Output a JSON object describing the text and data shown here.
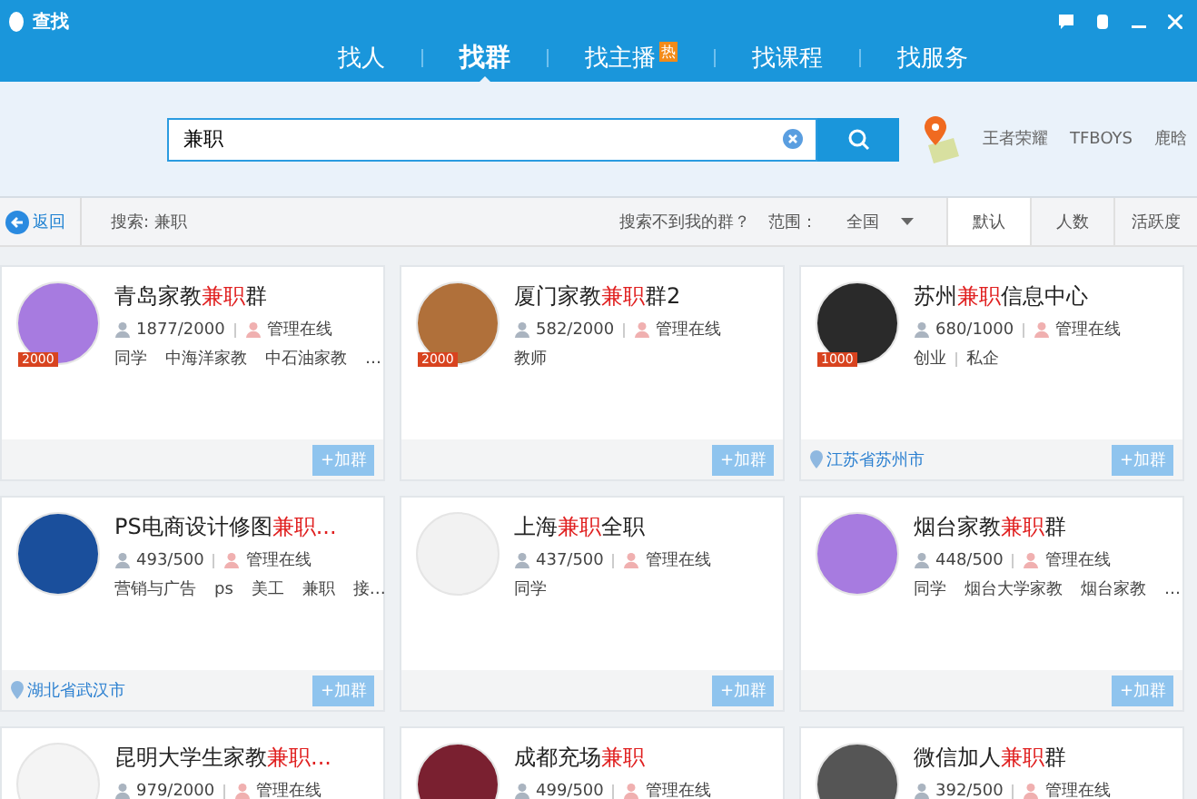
{
  "window": {
    "title": "查找"
  },
  "tabs": [
    {
      "label": "找人",
      "selected": false
    },
    {
      "label": "找群",
      "selected": true
    },
    {
      "label": "找主播",
      "selected": false,
      "badge": "热"
    },
    {
      "label": "找课程",
      "selected": false
    },
    {
      "label": "找服务",
      "selected": false
    }
  ],
  "search": {
    "value": "兼职"
  },
  "hot_keywords": [
    "王者荣耀",
    "TFBOYS",
    "鹿晗"
  ],
  "filter_bar": {
    "back": "返回",
    "query": "搜索: 兼职",
    "not_found": "搜索不到我的群？",
    "range_label": "范围：",
    "range_value": "全国",
    "sort_tabs": [
      {
        "label": "默认",
        "selected": true
      },
      {
        "label": "人数",
        "selected": false
      },
      {
        "label": "活跃度",
        "selected": false
      }
    ]
  },
  "groups": [
    {
      "title": [
        {
          "text": "青岛家教",
          "highlight": false
        },
        {
          "text": "兼职",
          "highlight": true
        },
        {
          "text": "群",
          "highlight": false
        }
      ],
      "color": "#a77be0",
      "badge": "2000",
      "members": "1877/2000",
      "admin": "管理在线",
      "tags": [
        "同学",
        "中海洋家教",
        "中石油家教",
        "…"
      ],
      "join": "+加群"
    },
    {
      "title": [
        {
          "text": "厦门家教",
          "highlight": false
        },
        {
          "text": "兼职",
          "highlight": true
        },
        {
          "text": "群2",
          "highlight": false
        }
      ],
      "color": "#b0703a",
      "badge": "2000",
      "members": "582/2000",
      "admin": "管理在线",
      "tags": [
        "教师"
      ],
      "join": "+加群"
    },
    {
      "title": [
        {
          "text": "苏州",
          "highlight": false
        },
        {
          "text": "兼职",
          "highlight": true
        },
        {
          "text": "信息中心",
          "highlight": false
        }
      ],
      "color": "#2a2a2a",
      "badge": "1000",
      "members": "680/1000",
      "admin": "管理在线",
      "tags": [
        "创业",
        "私企"
      ],
      "location": "江苏省苏州市",
      "join": "+加群"
    },
    {
      "title": [
        {
          "text": "PS电商设计修图",
          "highlight": false
        },
        {
          "text": "兼职...",
          "highlight": true
        }
      ],
      "color": "#1a4f9c",
      "members": "493/500",
      "admin": "管理在线",
      "tags": [
        "营销与广告",
        "ps",
        "美工",
        "兼职",
        "接…"
      ],
      "location": "湖北省武汉市",
      "join": "+加群"
    },
    {
      "title": [
        {
          "text": "上海",
          "highlight": false
        },
        {
          "text": "兼职",
          "highlight": true
        },
        {
          "text": "全职",
          "highlight": false
        }
      ],
      "color": "#f2f2f2",
      "members": "437/500",
      "admin": "管理在线",
      "tags": [
        "同学"
      ],
      "join": "+加群"
    },
    {
      "title": [
        {
          "text": "烟台家教",
          "highlight": false
        },
        {
          "text": "兼职",
          "highlight": true
        },
        {
          "text": "群",
          "highlight": false
        }
      ],
      "color": "#a77be0",
      "members": "448/500",
      "admin": "管理在线",
      "tags": [
        "同学",
        "烟台大学家教",
        "烟台家教",
        "…"
      ],
      "join": "+加群"
    },
    {
      "title": [
        {
          "text": "昆明大学生家教",
          "highlight": false
        },
        {
          "text": "兼职...",
          "highlight": true
        }
      ],
      "color": "#f4f4f4",
      "members": "979/2000",
      "admin": "管理在线"
    },
    {
      "title": [
        {
          "text": "成都充场",
          "highlight": false
        },
        {
          "text": "兼职",
          "highlight": true
        }
      ],
      "color": "#7a2030",
      "members": "499/500",
      "admin": "管理在线"
    },
    {
      "title": [
        {
          "text": "微信加人",
          "highlight": false
        },
        {
          "text": "兼职",
          "highlight": true
        },
        {
          "text": "群",
          "highlight": false
        }
      ],
      "color": "#555555",
      "members": "392/500",
      "admin": "管理在线"
    }
  ]
}
